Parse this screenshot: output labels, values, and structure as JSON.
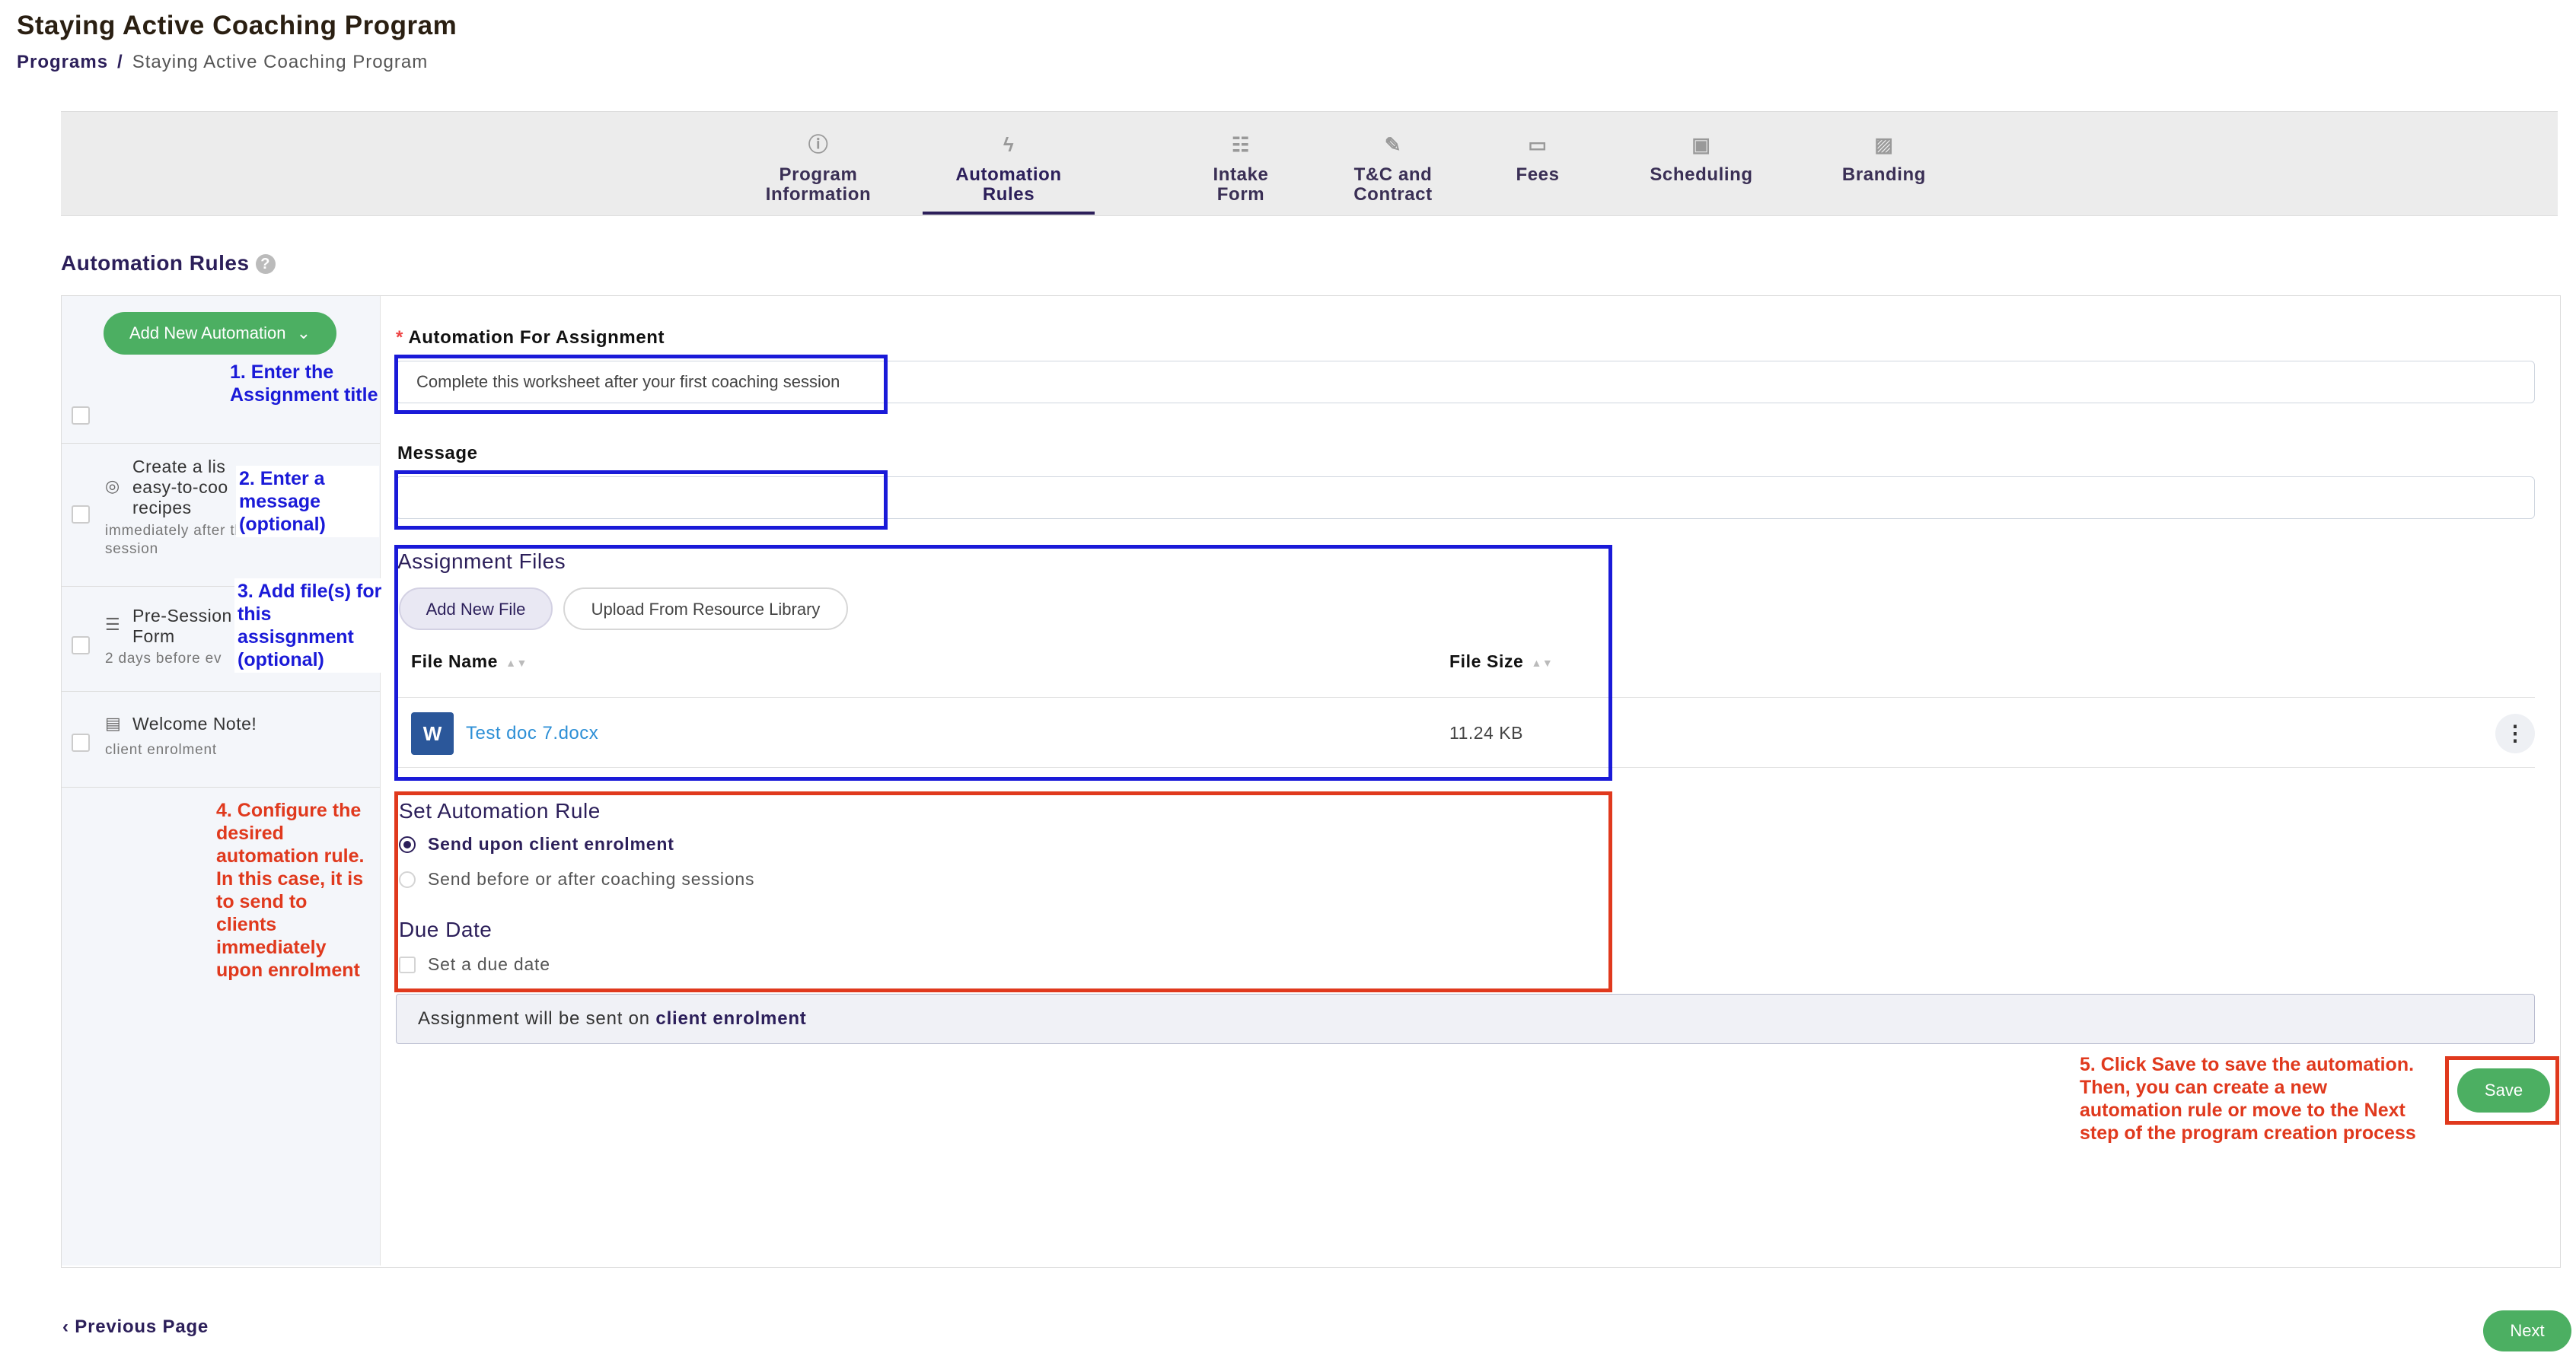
{
  "page": {
    "title": "Staying Active Coaching Program",
    "breadcrumb": {
      "parent": "Programs",
      "separator": "/",
      "current": "Staying Active Coaching Program"
    }
  },
  "tabs": [
    {
      "line1": "Program",
      "line2": "Information",
      "icon": "info-circle-icon",
      "glyph": "ⓘ"
    },
    {
      "line1": "Automation",
      "line2": "Rules",
      "icon": "lightning-icon",
      "glyph": "ϟ",
      "active": true
    },
    {
      "line1": "Intake",
      "line2": "Form",
      "icon": "checklist-icon",
      "glyph": "☷"
    },
    {
      "line1": "T&C and",
      "line2": "Contract",
      "icon": "contract-sign-icon",
      "glyph": "✎"
    },
    {
      "line1": "Fees",
      "line2": "",
      "icon": "credit-card-icon",
      "glyph": "▭"
    },
    {
      "line1": "Scheduling",
      "line2": "",
      "icon": "calendar-icon",
      "glyph": "▣"
    },
    {
      "line1": "Branding",
      "line2": "",
      "icon": "image-icon",
      "glyph": "▨"
    }
  ],
  "section": {
    "title": "Automation Rules",
    "help_glyph": "?"
  },
  "sidebar": {
    "add_button": "Add New Automation",
    "add_chevron": "⌄",
    "items": [
      {
        "title_lines": [
          "Create a lis",
          "easy-to-coo",
          "recipes"
        ],
        "subtitle_lines": [
          "immediately after the first",
          "session"
        ],
        "icon": "target-icon",
        "glyph": "◎"
      },
      {
        "title_lines": [
          "Pre-Session",
          "Form"
        ],
        "subtitle_lines": [
          "2 days before ev"
        ],
        "icon": "checklist-icon",
        "glyph": "☰"
      },
      {
        "title_lines": [
          "Welcome Note!"
        ],
        "subtitle_lines": [
          "client enrolment"
        ],
        "icon": "document-icon",
        "glyph": "▤"
      }
    ]
  },
  "form": {
    "assignment_label": "Automation For Assignment",
    "required_mark": "*",
    "assignment_value": "Complete this worksheet after your first coaching session",
    "message_label": "Message",
    "message_value": "",
    "files_heading": "Assignment Files",
    "add_file_button": "Add New File",
    "upload_library_button": "Upload From Resource Library",
    "table": {
      "col_name": "File Name",
      "col_size": "File Size",
      "sort_glyph": "▲▼",
      "rows": [
        {
          "name": "Test doc 7.docx",
          "size": "11.24 KB",
          "icon_letter": "W",
          "menu_glyph": "⋮"
        }
      ]
    },
    "rule_heading": "Set Automation Rule",
    "rule_options": [
      {
        "label": "Send upon client enrolment",
        "selected": true
      },
      {
        "label": "Send before or after coaching sessions",
        "selected": false
      }
    ],
    "due_heading": "Due Date",
    "due_checkbox_label": "Set a due date",
    "info_prefix": "Assignment will be sent on ",
    "info_bold": "client enrolment",
    "save_button": "Save"
  },
  "footer": {
    "prev_arrow": "‹",
    "prev_label": "Previous Page",
    "next_button": "Next"
  },
  "annotations": {
    "a1": [
      "1. Enter the",
      "Assignment title"
    ],
    "a2": [
      "2. Enter a",
      "message",
      "(optional)"
    ],
    "a3": [
      "3. Add file(s) for",
      "this",
      "assisgnment",
      "(optional)"
    ],
    "a4": [
      "4. Configure the",
      "desired",
      "automation rule.",
      "In this case, it is",
      "to send to",
      "clients",
      "immediately",
      "upon enrolment"
    ],
    "a5": [
      "5. Click Save to save the automation.",
      "Then, you can create a new",
      "automation rule or move to the Next",
      "step of the program creation process"
    ],
    "colors": {
      "blue": "#1a1ad8",
      "red": "#e0391d",
      "brand": "#2c1f5a",
      "green": "#4caf62"
    }
  }
}
